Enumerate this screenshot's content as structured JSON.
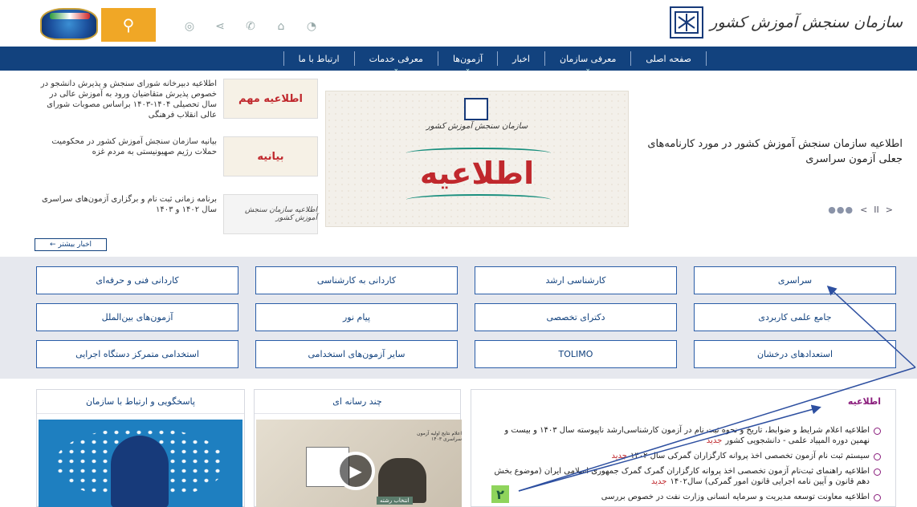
{
  "header": {
    "org_name": "سازمان سنجش آموزش کشور",
    "icons": [
      "search-icon",
      "globe-icon",
      "share-icon",
      "phone-icon",
      "home-icon",
      "rss-icon"
    ],
    "search_symbol": "⚲"
  },
  "nav": {
    "items": [
      {
        "label": "صفحه اصلی",
        "sub": false
      },
      {
        "label": "معرفی سازمان",
        "sub": true
      },
      {
        "label": "اخبار",
        "sub": false
      },
      {
        "label": "آزمون‌ها",
        "sub": true
      },
      {
        "label": "معرفی خدمات",
        "sub": true
      },
      {
        "label": "ارتباط با ما",
        "sub": false
      }
    ]
  },
  "slider": {
    "caption": "اطلاعیه سازمان سنجش آموزش کشور در مورد کارنامه‌های جعلی آزمون سراسری",
    "image_title": "اطلاعیه",
    "image_org": "سازمان سنجش آموزش کشور",
    "controls": {
      "dots": "●●●",
      "prev": "<",
      "pause": "II",
      "next": ">"
    }
  },
  "news": [
    {
      "thumb": "اطلاعیه مهم",
      "text": "اطلاعیه دبیرخانه شورای سنجش و پذیرش دانشجو در خصوص پذیرش متقاضیان ورود به آموزش عالی در سال تحصیلی ۱۴۰۴-۱۴۰۳ براساس مصوبات شورای عالی انقلاب فرهنگی"
    },
    {
      "thumb": "بیانیه",
      "text": "بیانیه سازمان سنجش آموزش کشور در محکومیت حملات رژیم صهیونیستی به مردم غزه"
    },
    {
      "thumb": "اطلاعیه سازمان سنجش آموزش کشور",
      "text": "برنامه زمانی ثبت نام و برگزاری آزمون‌های سراسری سال ۱۴۰۲ و ۱۴۰۳"
    }
  ],
  "more_news": "اخبار بیشتر ←",
  "exams": [
    "سراسری",
    "کارشناسی ارشد",
    "کاردانی به کارشناسی",
    "کاردانی فنی و حرفه‌ای",
    "جامع علمی کاربردی",
    "دکترای تخصصی",
    "پیام نور",
    "آزمون‌های بین‌الملل",
    "استعدادهای درخشان",
    "TOLIMO",
    "سایر آزمون‌های استخدامی",
    "استخدامی متمرکز دستگاه اجرایی"
  ],
  "panels": {
    "notices_title": "اطلاعیه",
    "media_title": "چند رسانه ای",
    "contact_title": "پاسخگویی و ارتباط با سازمان",
    "media_caption": "اعلام نتایج اولیه آزمون سراسری ۱۴۰۳",
    "media_tag": "انتخاب رشته",
    "new_label": "جدید",
    "notices": [
      {
        "text": "اطلاعیه اعلام شرایط و ضوابط، تاریخ و نحوه ثبت نام در آزمون کارشناسی‌ارشد ناپیوسته سال ۱۴۰۳ و بیست و نهمین دوره المپیاد علمی - دانشجویی کشور",
        "new": true
      },
      {
        "text": "سیستم ثبت نام آزمون تخصصی اخذ پروانه کارگزاران گمرکی سال ۱۴۰۲",
        "new": true
      },
      {
        "text": "اطلاعیه راهنمای ثبت‌نام آزمون تخصصی اخذ پروانه کارگزاران گمرک گمرک جمهوری اسلامی ایران (موضوع بخش دهم قانون و آیین نامه اجرایی قانون امور گمرکی) سال۱۴۰۲",
        "new": true
      },
      {
        "text": "اطلاعیه معاونت توسعه مدیریت و سرمایه انسانی وزارت نفت در خصوص بررسی",
        "new": false
      }
    ]
  },
  "annotation": {
    "label": "۲"
  },
  "colors": {
    "nav": "#12427e",
    "accent": "#f0a726",
    "notice": "#8a1d7c",
    "new": "#c0282d"
  }
}
